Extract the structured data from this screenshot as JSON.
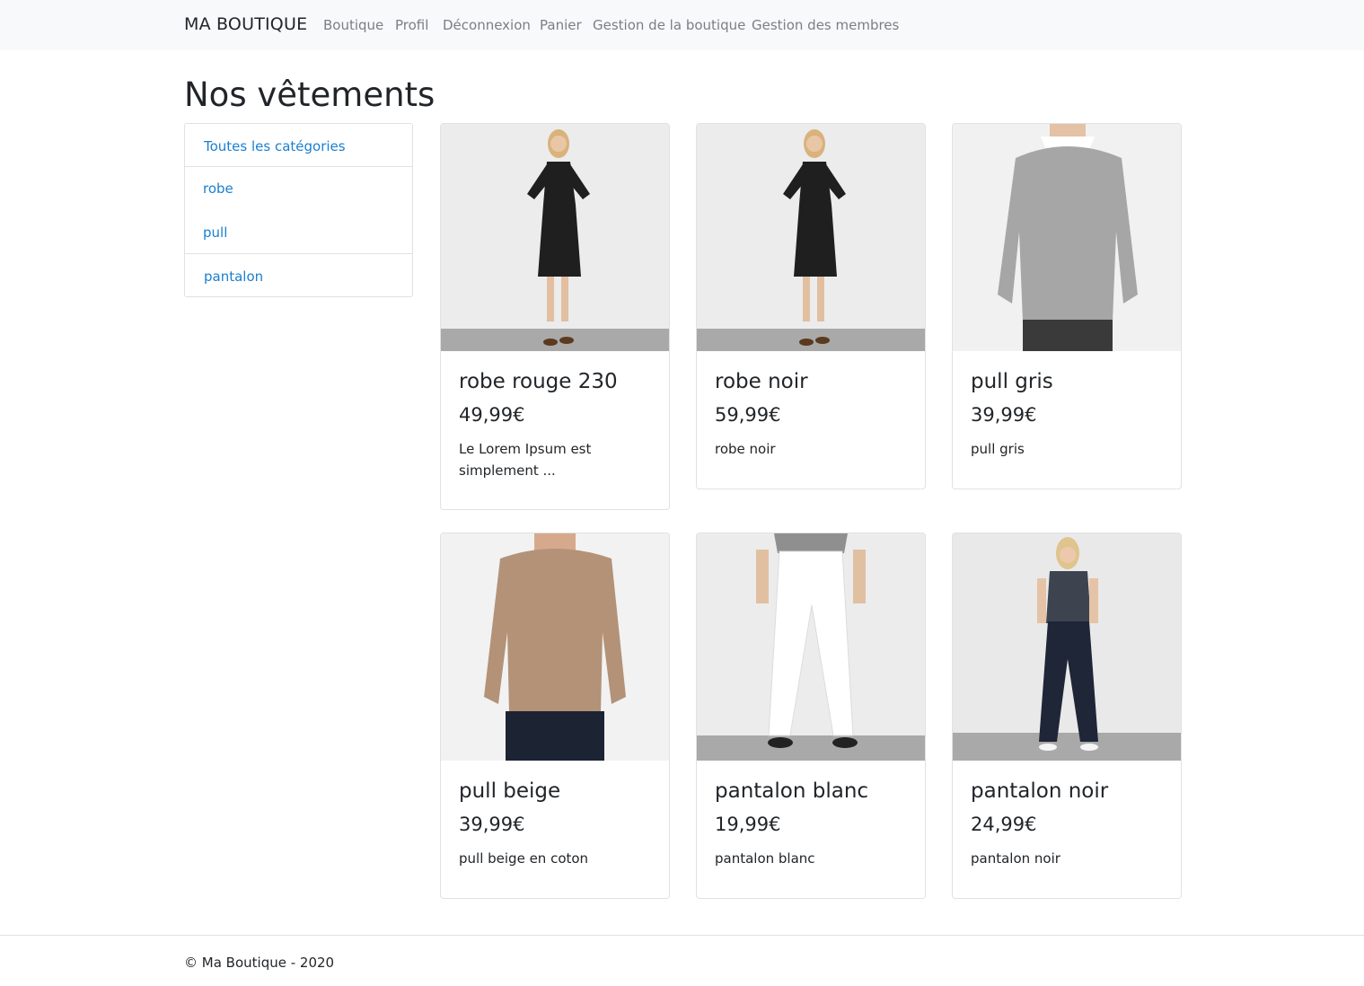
{
  "navbar": {
    "brand": "MA BOUTIQUE",
    "links": [
      "Boutique",
      "Profil",
      "Déconnexion",
      "Panier",
      "Gestion de la boutique",
      "Gestion des membres"
    ]
  },
  "page": {
    "title": "Nos vêtements"
  },
  "categories": {
    "all_label": "Toutes les catégories",
    "items": [
      "robe",
      "pull",
      "pantalon"
    ]
  },
  "products": [
    {
      "title": "robe rouge 230",
      "price": "49,99€",
      "description": "Le Lorem Ipsum est simplement ...",
      "image": "black-dress-woman"
    },
    {
      "title": "robe noir",
      "price": "59,99€",
      "description": "robe noir",
      "image": "black-dress-woman"
    },
    {
      "title": "pull gris",
      "price": "39,99€",
      "description": "pull gris",
      "image": "grey-sweater-man"
    },
    {
      "title": "pull beige",
      "price": "39,99€",
      "description": "pull beige en coton",
      "image": "beige-sweater-man"
    },
    {
      "title": "pantalon blanc",
      "price": "19,99€",
      "description": "pantalon blanc",
      "image": "white-pants-man"
    },
    {
      "title": "pantalon noir",
      "price": "24,99€",
      "description": "pantalon noir",
      "image": "dark-pants-woman"
    }
  ],
  "footer": {
    "text": "© Ma Boutique - 2020"
  },
  "colors": {
    "link": "#1a7fcf",
    "navbar_bg": "#f8f9fa",
    "border": "#dee2e6",
    "nav_link": "#7a7f85"
  }
}
